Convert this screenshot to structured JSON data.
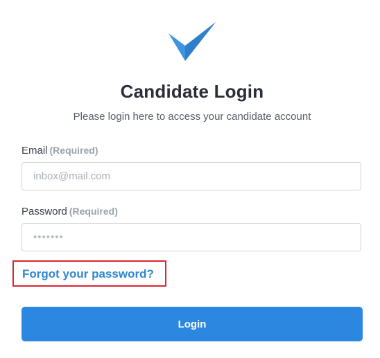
{
  "logo": {
    "icon": "checkmark-logo-icon",
    "color": "#3d95e0"
  },
  "header": {
    "title": "Candidate Login",
    "subtitle": "Please login here to access your candidate account"
  },
  "form": {
    "email": {
      "label": "Email",
      "required_tag": "(Required)",
      "placeholder": "inbox@mail.com",
      "value": ""
    },
    "password": {
      "label": "Password",
      "required_tag": "(Required)",
      "masked_value": "•••••••"
    },
    "forgot_link": "Forgot your password?",
    "login_button": "Login"
  },
  "colors": {
    "accent": "#2b87e0",
    "link": "#2f86d3",
    "highlight_border": "#d9252f"
  }
}
